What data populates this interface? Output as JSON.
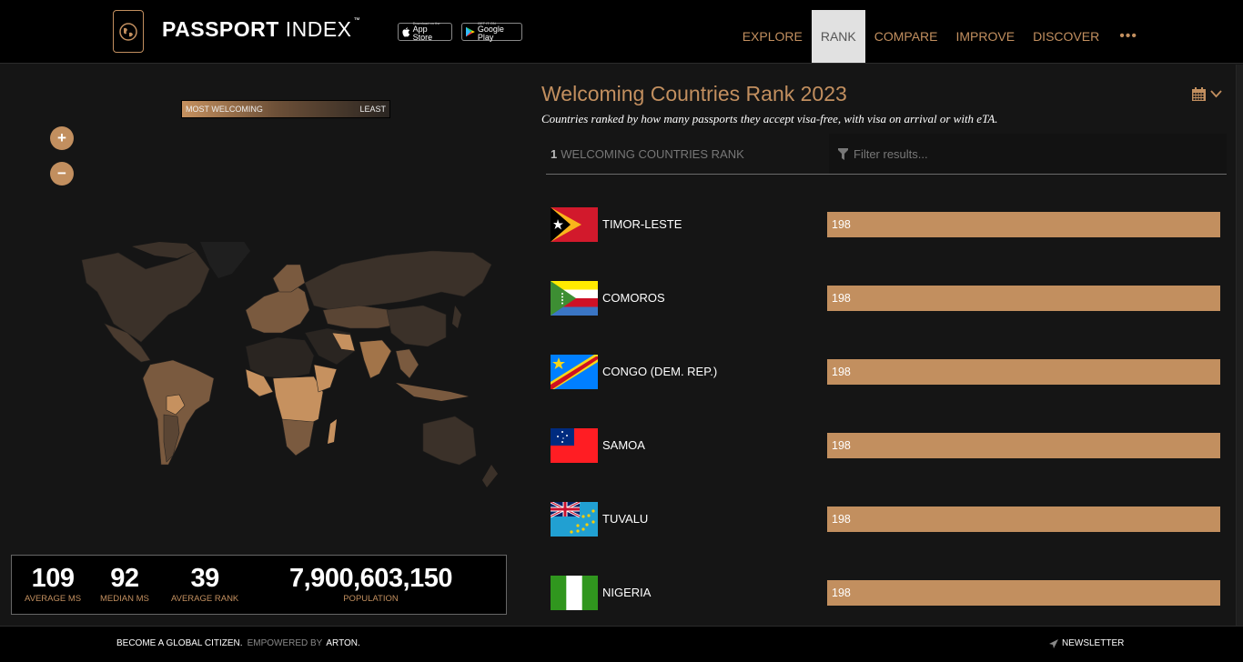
{
  "header": {
    "logo_bold": "PASSPORT",
    "logo_light": "INDEX",
    "logo_tm": "™",
    "app_store": {
      "small": "Download on the",
      "big": "App Store"
    },
    "google_play": {
      "small": "GET IT ON",
      "big": "Google Play"
    },
    "nav": [
      {
        "label": "EXPLORE",
        "active": false
      },
      {
        "label": "RANK",
        "active": true
      },
      {
        "label": "COMPARE",
        "active": false
      },
      {
        "label": "IMPROVE",
        "active": false
      },
      {
        "label": "DISCOVER",
        "active": false
      }
    ],
    "more_label": "•••"
  },
  "map": {
    "legend_left": "MOST WELCOMING",
    "legend_right": "LEAST",
    "zoom_in": "+",
    "zoom_out": "−",
    "colors": {
      "most": "#c6915f",
      "mid": "#7a5a3f",
      "dark": "#3b3129",
      "least": "#2a2521"
    }
  },
  "stats": [
    {
      "value": "109",
      "label": "AVERAGE MS"
    },
    {
      "value": "92",
      "label": "MEDIAN MS"
    },
    {
      "value": "39",
      "label": "AVERAGE RANK"
    },
    {
      "value": "7,900,603,150",
      "label": "POPULATION"
    }
  ],
  "rank": {
    "title": "Welcoming Countries Rank 2023",
    "subtitle": "Countries ranked by how many passports they accept visa-free, with visa on arrival or with eTA.",
    "column_rank": "1",
    "column_label": "WELCOMING COUNTRIES RANK",
    "filter_placeholder": "Filter results...",
    "filter_value": "",
    "max_value": 198,
    "rows": [
      {
        "country": "TIMOR-LESTE",
        "value": 198,
        "flag": "timor-leste"
      },
      {
        "country": "COMOROS",
        "value": 198,
        "flag": "comoros"
      },
      {
        "country": "CONGO (DEM. REP.)",
        "value": 198,
        "flag": "congo-dem-rep"
      },
      {
        "country": "SAMOA",
        "value": 198,
        "flag": "samoa"
      },
      {
        "country": "TUVALU",
        "value": 198,
        "flag": "tuvalu"
      },
      {
        "country": "NIGERIA",
        "value": 198,
        "flag": "nigeria"
      }
    ]
  },
  "footer": {
    "tagline": "BECOME A GLOBAL CITIZEN.",
    "powered_by": "EMPOWERED BY",
    "brand": "ARTON.",
    "newsletter": "NEWSLETTER"
  },
  "accent_color": "#c28f5f"
}
